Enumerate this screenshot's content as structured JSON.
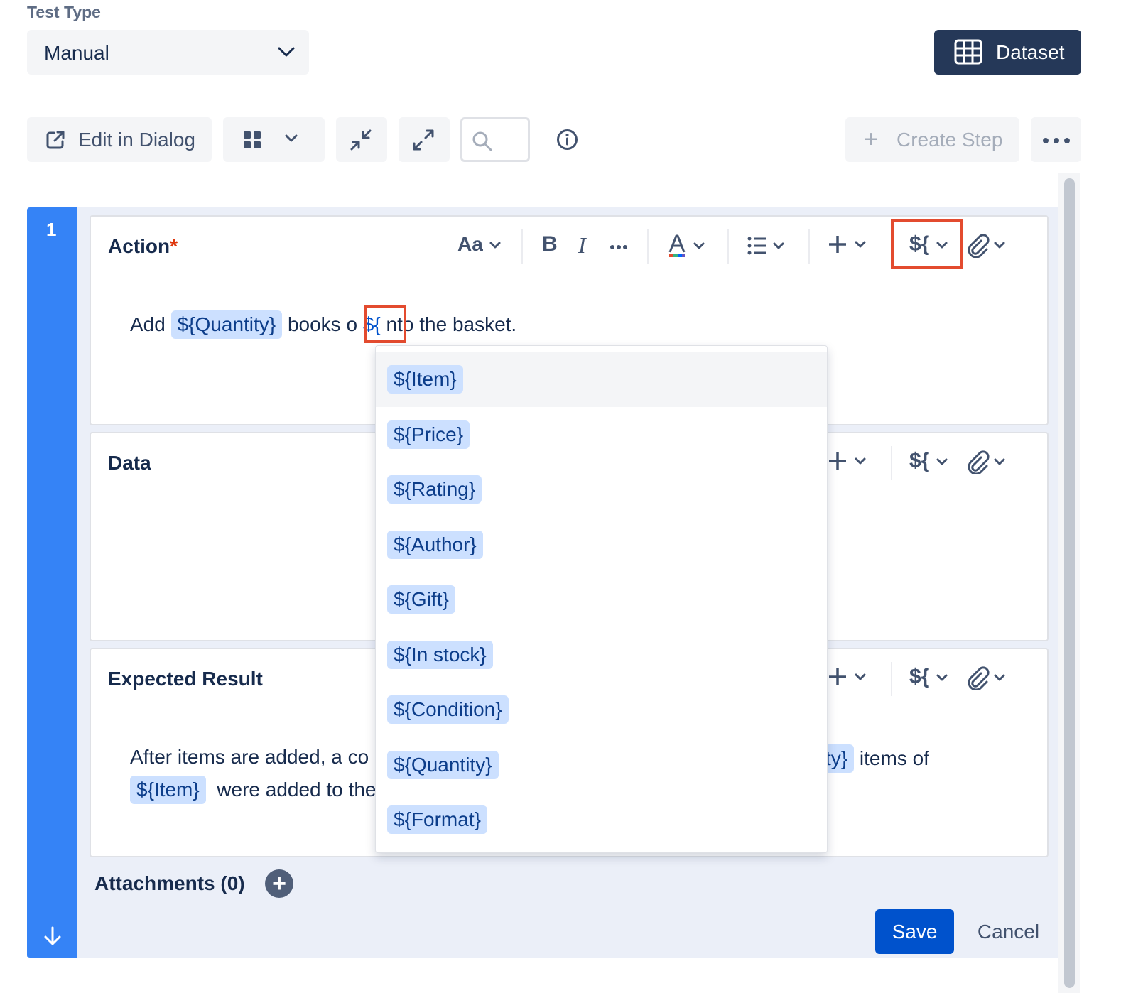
{
  "test_type": {
    "label": "Test Type",
    "value": "Manual"
  },
  "dataset_button": {
    "label": "Dataset"
  },
  "toolbar": {
    "edit_in_dialog": "Edit in Dialog",
    "create_step": "Create Step"
  },
  "step": {
    "number": "1",
    "action": {
      "title": "Action",
      "required_mark": "*",
      "toolbar": {
        "text_style": "Aa",
        "bold": "B",
        "italic": "I",
        "parameter": "${"
      },
      "text_before": "Add",
      "token_quantity": "${Quantity}",
      "text_middle": "books o",
      "token_partial": "${",
      "text_after": "nto the basket."
    },
    "data": {
      "title": "Data",
      "toolbar": {
        "parameter": "${"
      }
    },
    "expected": {
      "title": "Expected Result",
      "toolbar": {
        "parameter": "${"
      },
      "line1_start": "After items are added, a co",
      "line1_token_tail": "ty}",
      "line1_end": "items of",
      "line2_token": "${Item}",
      "line2_text": "were added to the"
    },
    "attachments_label": "Attachments (0)"
  },
  "parameter_dropdown": {
    "items": [
      "${Item}",
      "${Price}",
      "${Rating}",
      "${Author}",
      "${Gift}",
      "${In stock}",
      "${Condition}",
      "${Quantity}",
      "${Format}"
    ],
    "selected": "${Item}"
  },
  "footer": {
    "save": "Save",
    "cancel": "Cancel"
  },
  "colors": {
    "step_bar": "#3583f6",
    "primary_button": "#0052cc",
    "dataset_button": "#253858",
    "token_bg": "#cce0ff",
    "highlight_box": "#e34b2f"
  }
}
